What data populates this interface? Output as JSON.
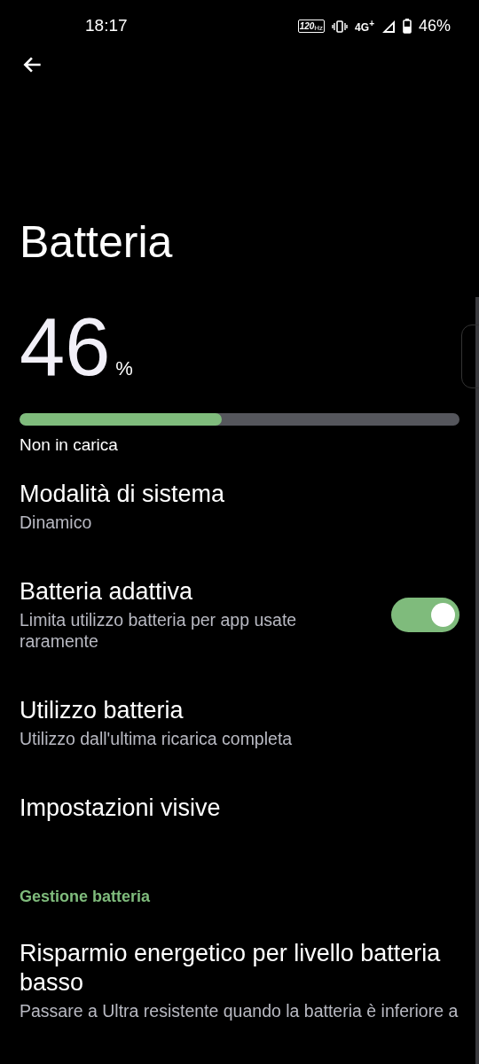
{
  "status_bar": {
    "time": "18:17",
    "refresh_rate": "120",
    "refresh_unit": "Hz",
    "network": "4G$^{+}$",
    "battery": "46%"
  },
  "title": "Batteria",
  "battery": {
    "percent": "46",
    "unit": "%",
    "level": 0.46,
    "state": "Non in carica"
  },
  "items": [
    {
      "kind": "plain",
      "title": "Modalità di sistema",
      "subtitle": "Dinamico"
    },
    {
      "kind": "switch",
      "title": "Batteria adattiva",
      "subtitle": "Limita utilizzo batteria per app usate raramente",
      "on": true
    },
    {
      "kind": "plain",
      "title": "Utilizzo batteria",
      "subtitle": "Utilizzo dall'ultima ricarica completa"
    },
    {
      "kind": "plain",
      "title": "Impostazioni visive"
    },
    {
      "kind": "header",
      "title": "Gestione batteria"
    },
    {
      "kind": "plain",
      "title": "Risparmio energetico per livello batteria basso",
      "subtitle": "Passare a Ultra resistente quando la batteria è inferiore a"
    }
  ]
}
